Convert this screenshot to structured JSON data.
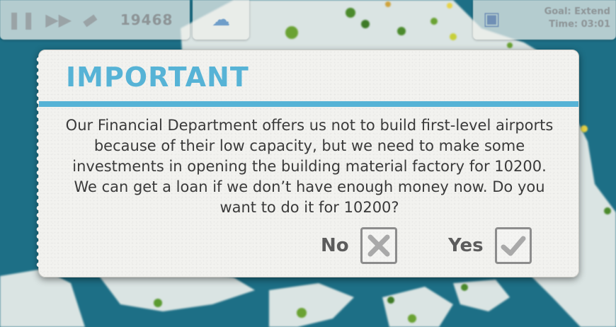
{
  "hud": {
    "pause_icon": "pause-icon",
    "fast_forward_icon": "fast-forward-icon",
    "money_icon": "banknote-icon",
    "money": "19468",
    "weather_icon": "rain-cloud-icon",
    "goal_icon": "clipboard-icon",
    "goal_line1": "Goal: Extend",
    "goal_line2": "Time: 03:01"
  },
  "dialog": {
    "title": "IMPORTANT",
    "message": "Our Financial Department offers us not to build first-level airports because of their low capacity, but we need to make some investments in opening the building material factory for 10200. We can get a loan if we don’t have enough money now. Do you want to do it for 10200?",
    "no_label": "No",
    "yes_label": "Yes",
    "accent_color": "#56b3d6"
  },
  "colors": {
    "sea": "#1d6f86",
    "land": "#e6ebe8",
    "dialog_bg": "#f2f2ef"
  }
}
